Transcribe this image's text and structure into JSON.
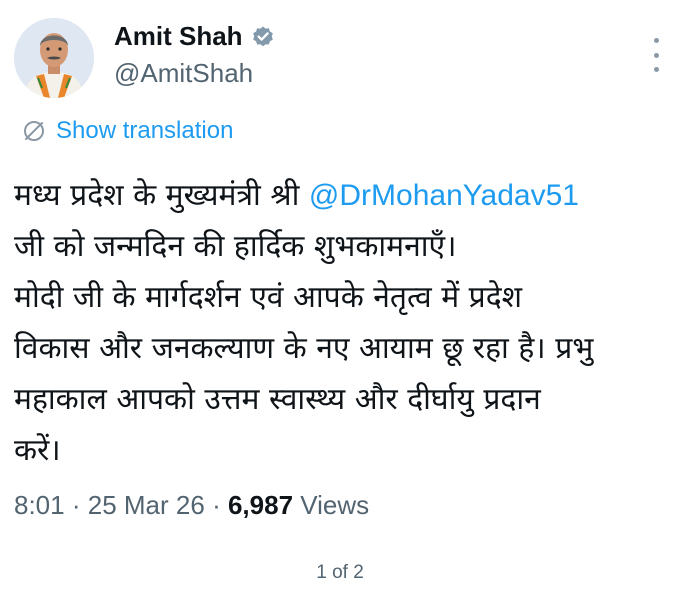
{
  "author": {
    "display_name": "Amit Shah",
    "handle": "@AmitShah",
    "verified_icon": "verified-badge-icon",
    "avatar": "profile-photo"
  },
  "translation": {
    "label": "Show translation",
    "icon": "globe-icon"
  },
  "tweet": {
    "line1_text": "मध्य प्रदेश के मुख्यमंत्री श्री ",
    "mention": "@DrMohanYadav51",
    "line2": "जी को जन्मदिन की हार्दिक शुभकामनाएँ।",
    "line3": "मोदी जी के मार्गदर्शन एवं आपके नेतृत्व में प्रदेश",
    "line4": "विकास और जनकल्याण के नए आयाम छू रहा है। प्रभु",
    "line5": "महाकाल आपको उत्तम स्वास्थ्य और दीर्घायु प्रदान",
    "line6": "करें।"
  },
  "meta": {
    "time": "8:01",
    "separator": "·",
    "date": "25 Mar 26",
    "views_count": "6,987",
    "views_label": "Views"
  },
  "pager": {
    "label": "1 of 2"
  },
  "colors": {
    "link": "#1d9bf0",
    "text": "#0f1419",
    "secondary": "#536471",
    "verified_badge": "#829aab"
  }
}
